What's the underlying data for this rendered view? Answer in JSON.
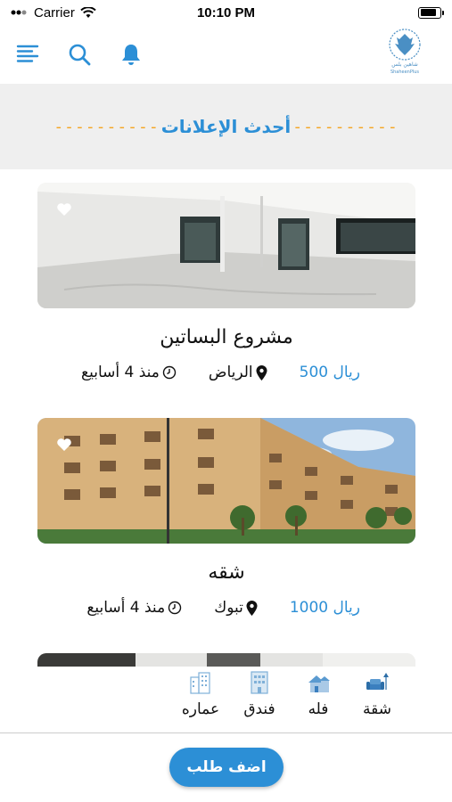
{
  "status_bar": {
    "carrier": "Carrier",
    "time": "10:10 PM",
    "battery_level": 0.85
  },
  "header": {
    "menu_icon": "menu-lines-icon",
    "search_icon": "search-icon",
    "notification_icon": "bell-icon",
    "logo_icon": "shaheen-plus-logo",
    "logo_text": "ShaheenPlus"
  },
  "section": {
    "dashes": "----------",
    "title": "أحدث الإعلانات"
  },
  "listings": [
    {
      "title": "مشروع البساتين",
      "price": "500 ريال",
      "location": "الرياض",
      "time_ago": "منذ 4 أسابيع"
    },
    {
      "title": "شقه",
      "price": "1000 ريال",
      "location": "تبوك",
      "time_ago": "منذ 4 أسابيع"
    }
  ],
  "categories": [
    {
      "label": "شقة",
      "icon": "apartment-sofa-icon"
    },
    {
      "label": "فله",
      "icon": "villa-icon"
    },
    {
      "label": "فندق",
      "icon": "hotel-icon"
    },
    {
      "label": "عماره",
      "icon": "building-icon"
    }
  ],
  "actions": {
    "add_request": "اضف طلب"
  },
  "colors": {
    "accent": "#2c8fd6",
    "dashes": "#f5a623",
    "header_bg": "#efefef"
  }
}
